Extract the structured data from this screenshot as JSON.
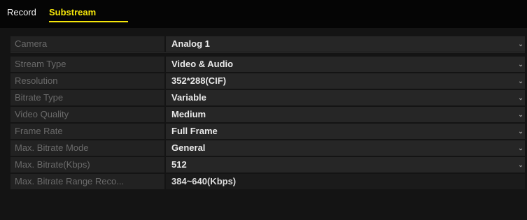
{
  "tabs": {
    "record": "Record",
    "substream": "Substream"
  },
  "icons": {
    "dropdown": "chevron-down-icon"
  },
  "colors": {
    "active_tab": "#f5e60a",
    "label_text": "#6a6a6a",
    "value_text": "#e9e9e9"
  },
  "settings": {
    "camera": {
      "label": "Camera",
      "value": "Analog 1"
    },
    "stream_type": {
      "label": "Stream Type",
      "value": "Video & Audio"
    },
    "resolution": {
      "label": "Resolution",
      "value": "352*288(CIF)"
    },
    "bitrate_type": {
      "label": "Bitrate Type",
      "value": "Variable"
    },
    "video_quality": {
      "label": "Video Quality",
      "value": "Medium"
    },
    "frame_rate": {
      "label": "Frame Rate",
      "value": "Full Frame"
    },
    "max_bitrate_mode": {
      "label": "Max. Bitrate Mode",
      "value": "General"
    },
    "max_bitrate": {
      "label": "Max. Bitrate(Kbps)",
      "value": "512"
    },
    "max_bitrate_range": {
      "label": "Max. Bitrate Range Reco...",
      "value": "384~640(Kbps)"
    }
  }
}
